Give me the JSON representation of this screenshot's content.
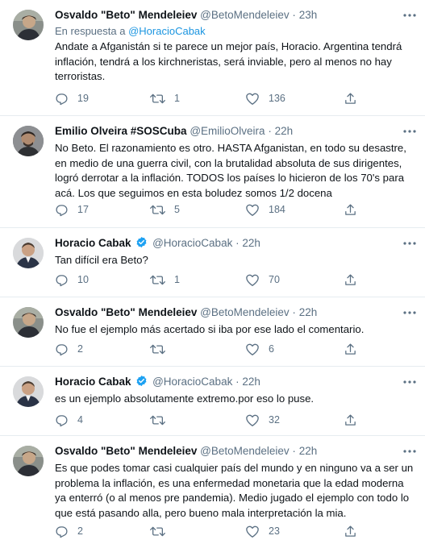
{
  "tweets": [
    {
      "name": "Osvaldo \"Beto\" Mendeleiev",
      "handle": "@BetoMendeleiev",
      "time": "23h",
      "reply_prefix": "En respuesta a",
      "reply_handle": "@HoracioCabak",
      "text": "Andate a Afganistán si te parece un mejor país, Horacio. Argentina tendrá inflación, tendrá a los kirchneristas, será inviable, pero al menos no hay terroristas.",
      "replies": "19",
      "retweets": "1",
      "likes": "136"
    },
    {
      "name": "Emilio Olveira #SOSCuba",
      "handle": "@EmilioOlveira",
      "time": "22h",
      "text": "No Beto. El razonamiento es otro. HASTA Afganistan, en todo su desastre, en medio de una guerra civil, con la brutalidad absoluta de sus dirigentes, logró derrotar a la inflación. TODOS los países lo hicieron de los 70's para acá. Los que seguimos en esta boludez somos 1/2 docena",
      "replies": "17",
      "retweets": "5",
      "likes": "184"
    },
    {
      "name": "Horacio Cabak",
      "handle": "@HoracioCabak",
      "time": "22h",
      "verified": true,
      "text": "Tan difícil era Beto?",
      "replies": "10",
      "retweets": "1",
      "likes": "70"
    },
    {
      "name": "Osvaldo \"Beto\" Mendeleiev",
      "handle": "@BetoMendeleiev",
      "time": "22h",
      "text": "No fue el ejemplo más acertado si iba por ese lado el comentario.",
      "replies": "2",
      "retweets": "",
      "likes": "6"
    },
    {
      "name": "Horacio Cabak",
      "handle": "@HoracioCabak",
      "time": "22h",
      "verified": true,
      "text": "es un ejemplo absolutamente extremo.por eso lo puse.",
      "replies": "4",
      "retweets": "",
      "likes": "32"
    },
    {
      "name": "Osvaldo \"Beto\" Mendeleiev",
      "handle": "@BetoMendeleiev",
      "time": "22h",
      "text": "Es que podes tomar casi cualquier país del mundo y en ninguno va a ser un problema la inflación, es una enfermedad monetaria que la edad moderna ya enterró (o al menos pre pandemia). Medio jugado el ejemplo con todo lo que está pasando alla, pero bueno mala interpretación la mia.",
      "replies": "2",
      "retweets": "",
      "likes": "23"
    }
  ],
  "colors": {
    "text": "#0f1419",
    "secondary": "#5b7083",
    "link": "#1b95e0",
    "verified": "#1da1f2",
    "divider": "#e6ecf0"
  },
  "icons": {
    "reply": "reply-icon",
    "retweet": "retweet-icon",
    "like": "like-icon",
    "share": "share-icon",
    "more": "more-icon",
    "verified": "verified-badge-icon"
  }
}
